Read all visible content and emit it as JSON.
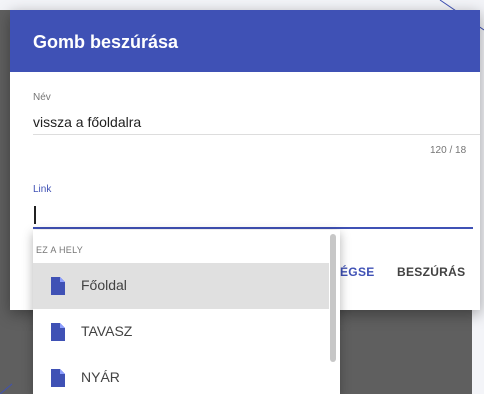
{
  "dialog": {
    "title": "Gomb beszúrása",
    "name_field": {
      "label": "Név",
      "value": "vissza a főoldalra",
      "counter": "120 / 18"
    },
    "link_field": {
      "label": "Link",
      "value": ""
    },
    "buttons": {
      "cancel": "ÉGSE",
      "insert": "BESZÚRÁS"
    }
  },
  "dropdown": {
    "section_header": "EZ A HELY",
    "items": [
      {
        "label": "Főoldal",
        "icon": "page-icon",
        "active": true
      },
      {
        "label": "TAVASZ",
        "icon": "page-icon",
        "active": false
      },
      {
        "label": "NYÁR",
        "icon": "page-icon",
        "active": false
      }
    ]
  },
  "colors": {
    "accent": "#3f51b5",
    "highlight": "#e0e0e0",
    "overlay": "#5f5f5f"
  }
}
